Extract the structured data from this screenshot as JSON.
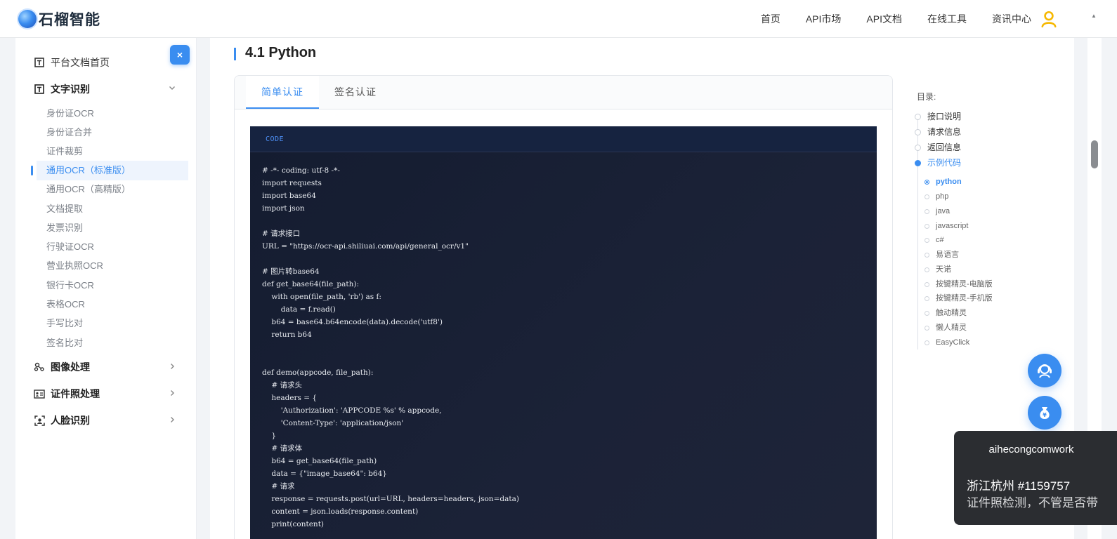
{
  "header": {
    "brand": "石榴智能",
    "nav": [
      "首页",
      "API市场",
      "API文档",
      "在线工具",
      "资讯中心"
    ]
  },
  "sidebar": {
    "close_label": "×",
    "home": "平台文档首页",
    "text_ocr": "文字识别",
    "sub_items": [
      "身份证OCR",
      "身份证合并",
      "证件裁剪",
      "通用OCR（标准版）",
      "通用OCR（高精版）",
      "文档提取",
      "发票识别",
      "行驶证OCR",
      "营业执照OCR",
      "银行卡OCR",
      "表格OCR",
      "手写比对",
      "签名比对"
    ],
    "image_proc": "图像处理",
    "id_photo": "证件照处理",
    "face": "人脸识别"
  },
  "main": {
    "section_title": "4.1 Python",
    "tabs": [
      "简单认证",
      "签名认证"
    ],
    "code_label": "CODE",
    "code_lines": [
      "# -*- coding: utf-8 -*-",
      "import requests",
      "import base64",
      "import json",
      "",
      "# 请求接口",
      "URL = \"https://ocr-api.shiliuai.com/api/general_ocr/v1\"",
      "",
      "# 图片转base64",
      "def get_base64(file_path):",
      "    with open(file_path, 'rb') as f:",
      "        data = f.read()",
      "    b64 = base64.b64encode(data).decode('utf8')",
      "    return b64",
      "",
      "",
      "def demo(appcode, file_path):",
      "    # 请求头",
      "    headers = {",
      "        'Authorization': 'APPCODE %s' % appcode,",
      "        'Content-Type': 'application/json'",
      "    }",
      "    # 请求体",
      "    b64 = get_base64(file_path)",
      "    data = {\"image_base64\": b64}",
      "    # 请求",
      "    response = requests.post(url=URL, headers=headers, json=data)",
      "    content = json.loads(response.content)",
      "    print(content)"
    ]
  },
  "toc": {
    "label": "目录:",
    "items": [
      "接口说明",
      "请求信息",
      "返回信息",
      "示例代码"
    ],
    "sub_items": [
      "python",
      "php",
      "java",
      "javascript",
      "c#",
      "易语言",
      "天诺",
      "按键精灵-电脑版",
      "按键精灵-手机版",
      "触动精灵",
      "懒人精灵",
      "EasyClick"
    ]
  },
  "toast": {
    "title": "aihecongcomwork",
    "line1": "浙江杭州 #1159757",
    "line2": "证件照检测，不管是否带"
  },
  "colors": {
    "accent": "#3a8df0",
    "code_bg": "#1b2237"
  }
}
